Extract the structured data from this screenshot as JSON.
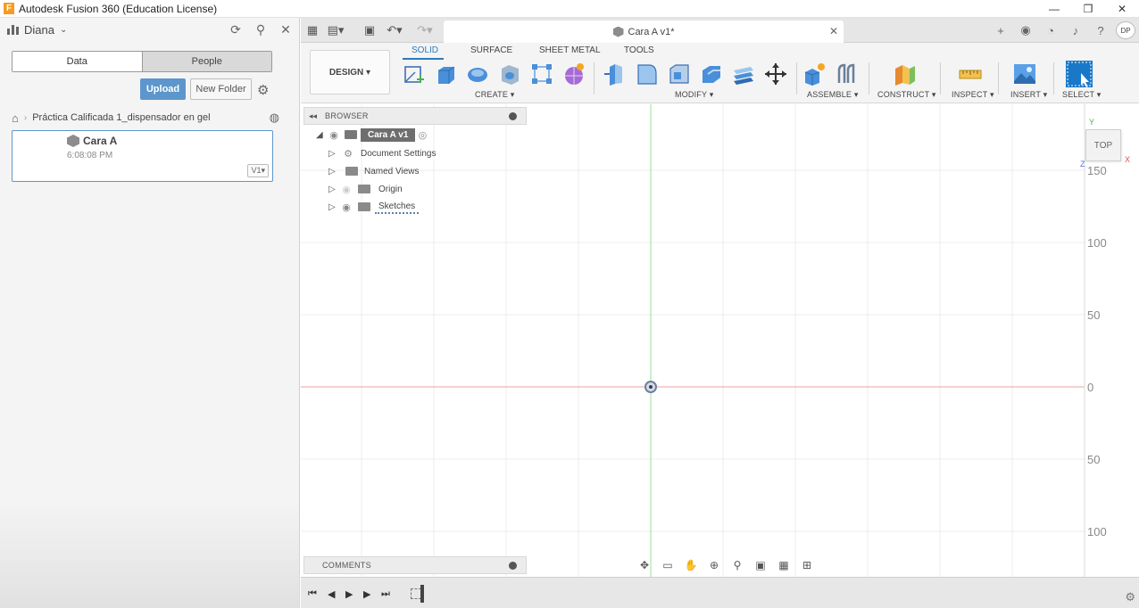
{
  "window": {
    "title": "Autodesk Fusion 360 (Education License)",
    "logo_letter": "F",
    "controls": [
      "—",
      "❐",
      "✕"
    ]
  },
  "data_panel": {
    "user": "Diana",
    "tabs": {
      "data": "Data",
      "people": "People"
    },
    "upload_label": "Upload",
    "new_folder_label": "New Folder",
    "breadcrumb": "Práctica Calificada 1_dispensador en gel",
    "file": {
      "name": "Cara A",
      "time": "6:08:08 PM",
      "version": "V1▾"
    }
  },
  "document_tab": {
    "title": "Cara A v1*"
  },
  "avatar_initials": "DP",
  "toolbar": {
    "workspace": "DESIGN ▾",
    "tabs": [
      "SOLID",
      "SURFACE",
      "SHEET METAL",
      "TOOLS"
    ],
    "groups": {
      "create": "CREATE ▾",
      "modify": "MODIFY ▾",
      "assemble": "ASSEMBLE ▾",
      "construct": "CONSTRUCT ▾",
      "inspect": "INSPECT ▾",
      "insert": "INSERT ▾",
      "select": "SELECT ▾"
    }
  },
  "browser": {
    "title": "BROWSER",
    "root": "Cara A v1",
    "items": [
      "Document Settings",
      "Named Views",
      "Origin",
      "Sketches"
    ]
  },
  "viewcube": {
    "face": "TOP",
    "axes": {
      "y": "Y",
      "x": "X",
      "z": "Z"
    }
  },
  "ruler_labels": [
    "150",
    "100",
    "50",
    "0",
    "50",
    "100"
  ],
  "comments_title": "COMMENTS",
  "colors": {
    "accent": "#2a7bbf",
    "upload_button": "#5c96cc",
    "x_axis": "#e8a0a0",
    "y_axis": "#9ede9e"
  }
}
